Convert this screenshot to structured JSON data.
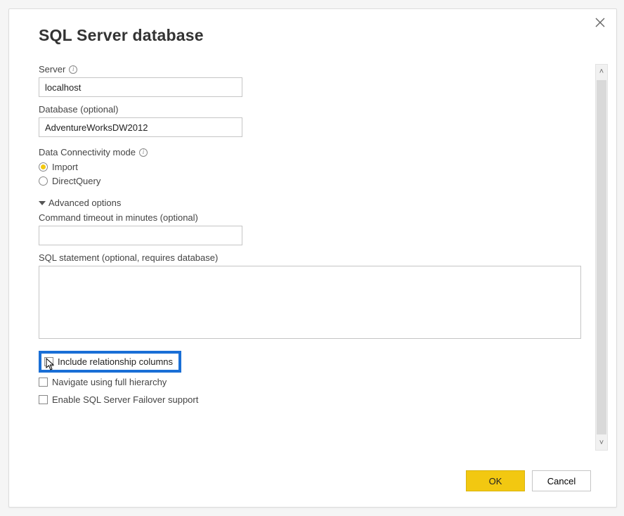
{
  "title": "SQL Server database",
  "server": {
    "label": "Server",
    "value": "localhost"
  },
  "database": {
    "label": "Database (optional)",
    "value": "AdventureWorksDW2012"
  },
  "connectivity": {
    "label": "Data Connectivity mode",
    "options": {
      "import": "Import",
      "directquery": "DirectQuery"
    },
    "selected": "import"
  },
  "advanced": {
    "label": "Advanced options",
    "command_timeout": {
      "label": "Command timeout in minutes (optional)",
      "value": ""
    },
    "sql_statement": {
      "label": "SQL statement (optional, requires database)",
      "value": ""
    },
    "checkboxes": {
      "include_relationship": {
        "label": "Include relationship columns",
        "checked": false
      },
      "navigate_hierarchy": {
        "label": "Navigate using full hierarchy",
        "checked": false
      },
      "failover": {
        "label": "Enable SQL Server Failover support",
        "checked": false
      }
    }
  },
  "buttons": {
    "ok": "OK",
    "cancel": "Cancel"
  }
}
